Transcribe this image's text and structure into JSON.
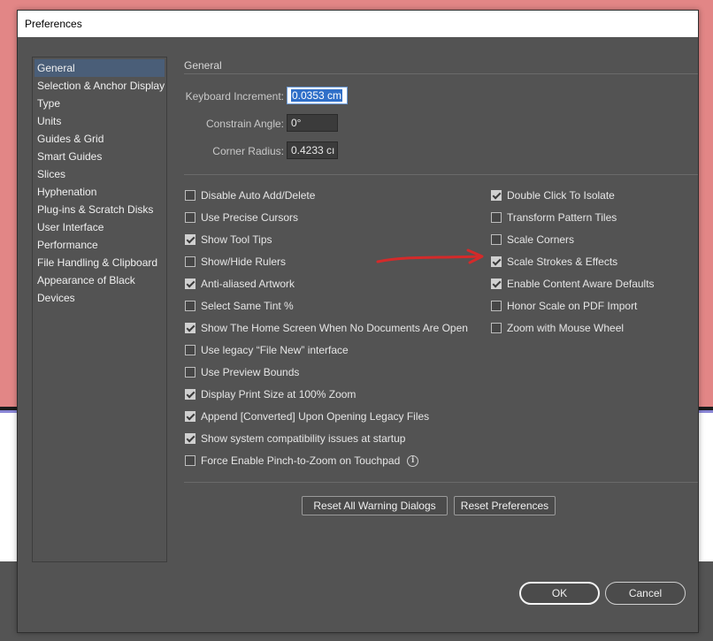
{
  "dialog": {
    "title": "Preferences"
  },
  "sidebar": {
    "items": [
      {
        "label": "General",
        "selected": true
      },
      {
        "label": "Selection & Anchor Display"
      },
      {
        "label": "Type"
      },
      {
        "label": "Units"
      },
      {
        "label": "Guides & Grid"
      },
      {
        "label": "Smart Guides"
      },
      {
        "label": "Slices"
      },
      {
        "label": "Hyphenation"
      },
      {
        "label": "Plug-ins & Scratch Disks"
      },
      {
        "label": "User Interface"
      },
      {
        "label": "Performance"
      },
      {
        "label": "File Handling & Clipboard"
      },
      {
        "label": "Appearance of Black"
      },
      {
        "label": "Devices"
      }
    ]
  },
  "general": {
    "section_title": "General",
    "keyboard_increment": {
      "label": "Keyboard Increment:",
      "value": "0.0353 cm"
    },
    "constrain_angle": {
      "label": "Constrain Angle:",
      "value": "0°"
    },
    "corner_radius": {
      "label": "Corner Radius:",
      "value": "0.4233 cı"
    }
  },
  "options_left": [
    {
      "label": "Disable Auto Add/Delete",
      "checked": false
    },
    {
      "label": "Use Precise Cursors",
      "checked": false
    },
    {
      "label": "Show Tool Tips",
      "checked": true
    },
    {
      "label": "Show/Hide Rulers",
      "checked": false
    },
    {
      "label": "Anti-aliased Artwork",
      "checked": true
    },
    {
      "label": "Select Same Tint %",
      "checked": false
    },
    {
      "label": "Show The Home Screen When No Documents Are Open",
      "checked": true
    },
    {
      "label": "Use legacy “File New” interface",
      "checked": false
    },
    {
      "label": "Use Preview Bounds",
      "checked": false
    },
    {
      "label": "Display Print Size at 100% Zoom",
      "checked": true
    },
    {
      "label": "Append [Converted] Upon Opening Legacy Files",
      "checked": true
    },
    {
      "label": "Show system compatibility issues at startup",
      "checked": true
    },
    {
      "label": "Force Enable Pinch-to-Zoom on Touchpad",
      "checked": false
    }
  ],
  "options_right": [
    {
      "label": "Double Click To Isolate",
      "checked": true
    },
    {
      "label": "Transform Pattern Tiles",
      "checked": false
    },
    {
      "label": "Scale Corners",
      "checked": false
    },
    {
      "label": "Scale Strokes & Effects",
      "checked": true
    },
    {
      "label": "Enable Content Aware Defaults",
      "checked": true
    },
    {
      "label": "Honor Scale on PDF Import",
      "checked": false
    },
    {
      "label": "Zoom with Mouse Wheel",
      "checked": false
    }
  ],
  "buttons": {
    "reset_warnings": "Reset All Warning Dialogs",
    "reset_prefs": "Reset Preferences",
    "ok": "OK",
    "cancel": "Cancel"
  },
  "icons": {
    "info": "info-icon",
    "annotation": "red-arrow"
  },
  "colors": {
    "dialog_bg": "#535353",
    "selection": "#4a5e78",
    "annotation_red": "#d42a2a",
    "background": "#e28686"
  }
}
